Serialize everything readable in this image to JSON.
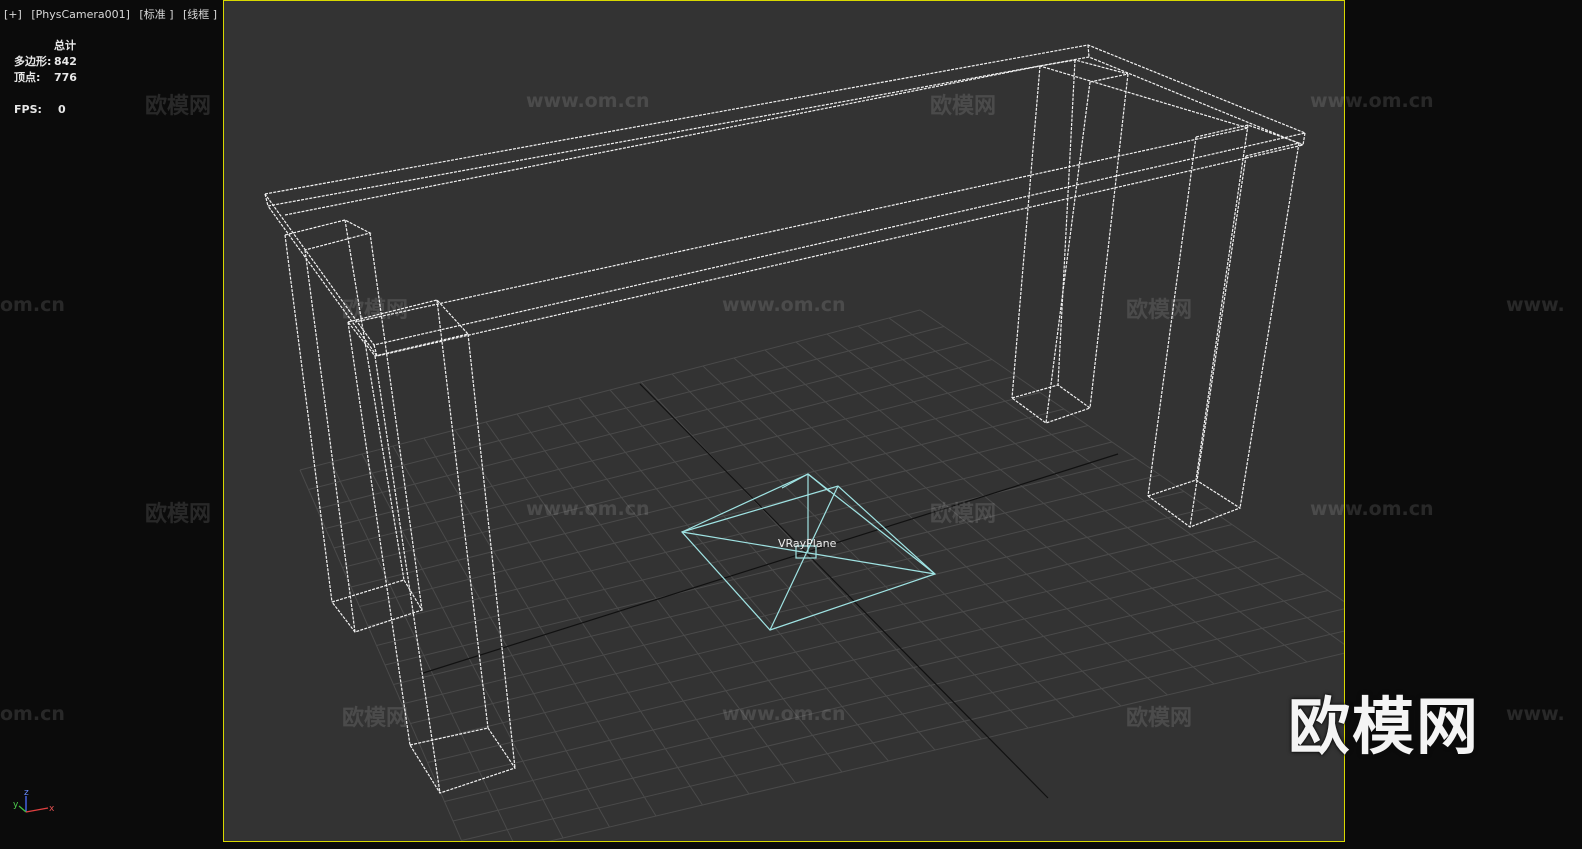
{
  "viewport": {
    "labels": [
      "[+]",
      "[PhysCamera001]",
      "[标准 ]",
      "[线框 ]"
    ]
  },
  "stats": {
    "header": "总计",
    "polygons_label": "多边形:",
    "polygons": "842",
    "vertices_label": "顶点:",
    "vertices": "776",
    "fps_label": "FPS:",
    "fps": "0"
  },
  "scene": {
    "object_label": "VRayPlane",
    "grid_color": "#4a4a4a",
    "wire_color": "#f2f2f2",
    "plane_color": "#9fe3e3"
  },
  "gizmo": {
    "z": "z",
    "y": "y",
    "x": "x"
  },
  "watermarks": {
    "brand": "欧模网",
    "url": "www.om.cn",
    "partial_url_left": "om.cn",
    "partial_url_right": "www."
  }
}
